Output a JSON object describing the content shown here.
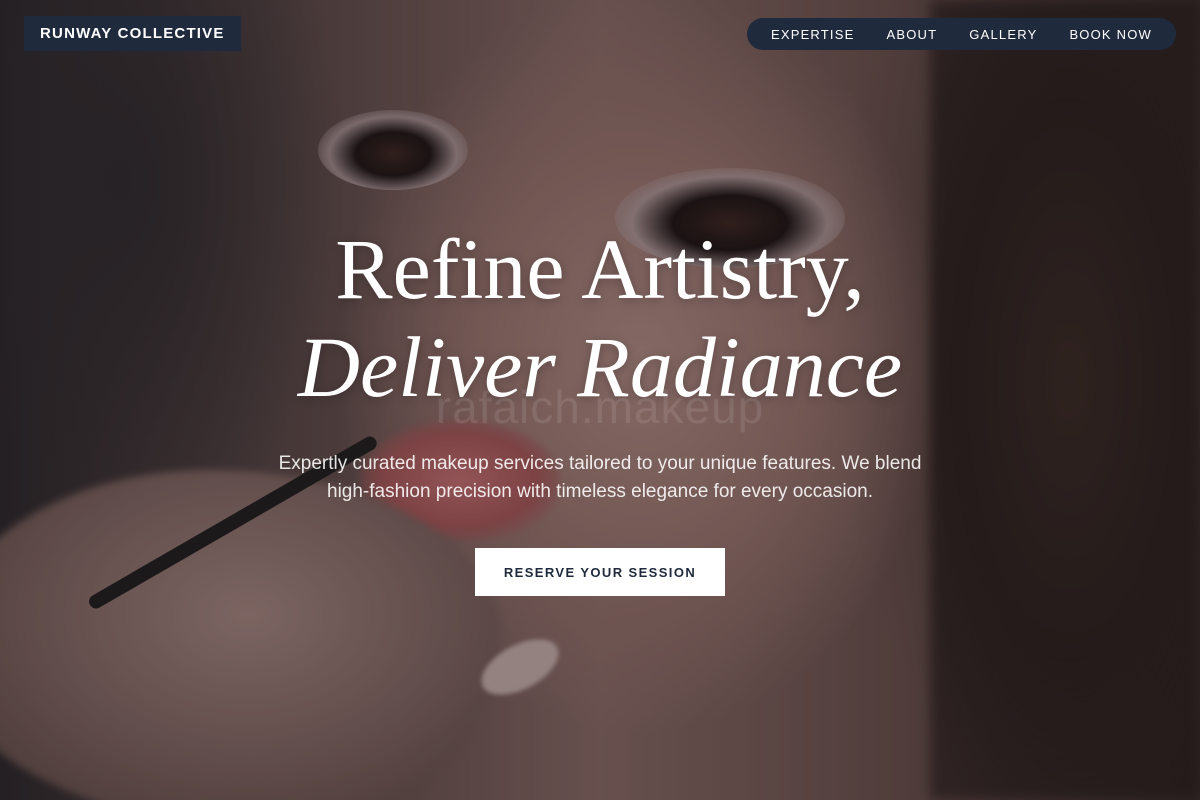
{
  "brand": {
    "name": "RUNWAY COLLECTIVE"
  },
  "nav": {
    "items": [
      {
        "label": "EXPERTISE"
      },
      {
        "label": "ABOUT"
      },
      {
        "label": "GALLERY"
      },
      {
        "label": "BOOK NOW"
      }
    ]
  },
  "hero": {
    "headline_line1": "Refine Artistry,",
    "headline_line2": "Deliver Radiance",
    "watermark": "rafaich.makeup",
    "subtext": "Expertly curated makeup services tailored to your unique features. We blend high-fashion precision with timeless elegance for every occasion.",
    "cta_label": "RESERVE YOUR SESSION",
    "background_image": "makeup-artist-applying-lipstick-photo"
  },
  "colors": {
    "brand_navy": "#1f2a3d",
    "cta_background": "#ffffff",
    "text_light": "#ffffff"
  }
}
